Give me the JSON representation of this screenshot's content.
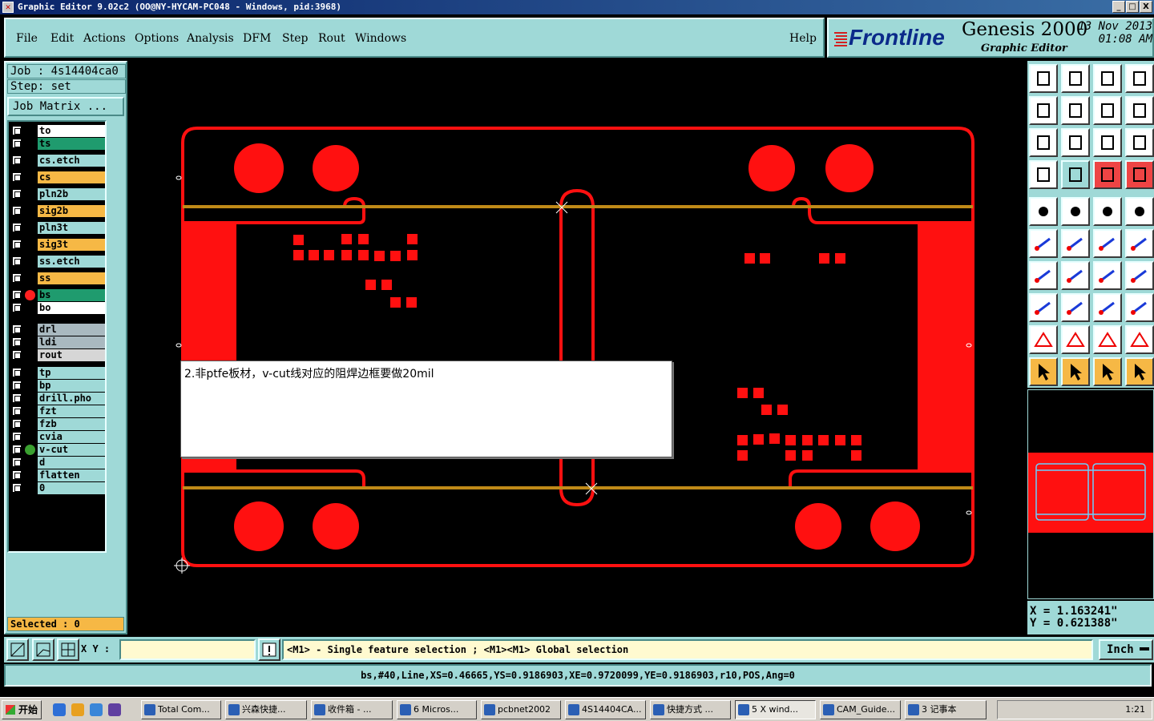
{
  "window": {
    "title": "Graphic Editor 9.02c2  (OO@NY-HYCAM-PC048 - Windows, pid:3968)",
    "min_label": "_",
    "max_label": "□",
    "close_label": "X"
  },
  "menu": {
    "items": [
      "File",
      "Edit",
      "Actions",
      "Options",
      "Analysis",
      "DFM",
      "Step",
      "Rout",
      "Windows"
    ],
    "help": "Help"
  },
  "logo": {
    "brand": "Frontline",
    "product": "Genesis 2000",
    "subtitle": "Graphic Editor",
    "date": "13 Nov 2013",
    "time": "01:08 AM"
  },
  "job": {
    "job_label": "Job : 4s14404ca0",
    "step_label": "Step: set",
    "matrix_button": "Job Matrix ..."
  },
  "layers": [
    {
      "name": "to",
      "color": "#ffffff",
      "dot": ""
    },
    {
      "name": "ts",
      "color": "#1f9b6e",
      "dot": ""
    },
    {
      "name": "cs.etch",
      "color": "#9fd9d7",
      "dot": ""
    },
    {
      "name": "cs",
      "color": "#f6b845",
      "dot": ""
    },
    {
      "name": "pln2b",
      "color": "#9fd9d7",
      "dot": ""
    },
    {
      "name": "sig2b",
      "color": "#f6b845",
      "dot": ""
    },
    {
      "name": "pln3t",
      "color": "#9fd9d7",
      "dot": ""
    },
    {
      "name": "sig3t",
      "color": "#f6b845",
      "dot": ""
    },
    {
      "name": "ss.etch",
      "color": "#9fd9d7",
      "dot": ""
    },
    {
      "name": "ss",
      "color": "#f6b845",
      "dot": ""
    },
    {
      "name": "bs",
      "color": "#1f9b6e",
      "dot": "#ff2020"
    },
    {
      "name": "bo",
      "color": "#ffffff",
      "dot": ""
    },
    {
      "name": "drl",
      "color": "#a9b9c0",
      "dot": ""
    },
    {
      "name": "ldi",
      "color": "#a9b9c0",
      "dot": ""
    },
    {
      "name": "rout",
      "color": "#d6d6d6",
      "dot": ""
    },
    {
      "name": "tp",
      "color": "#9fd9d7",
      "dot": ""
    },
    {
      "name": "bp",
      "color": "#9fd9d7",
      "dot": ""
    },
    {
      "name": "drill.pho",
      "color": "#9fd9d7",
      "dot": ""
    },
    {
      "name": "fzt",
      "color": "#9fd9d7",
      "dot": ""
    },
    {
      "name": "fzb",
      "color": "#9fd9d7",
      "dot": ""
    },
    {
      "name": "cvia",
      "color": "#9fd9d7",
      "dot": ""
    },
    {
      "name": "v-cut",
      "color": "#9fd9d7",
      "dot": "#3aa030"
    },
    {
      "name": "d",
      "color": "#9fd9d7",
      "dot": ""
    },
    {
      "name": "flatten",
      "color": "#9fd9d7",
      "dot": ""
    },
    {
      "name": "0",
      "color": "#9fd9d7",
      "dot": ""
    }
  ],
  "selected": "Selected : 0",
  "note": {
    "text": "2.非ptfe板材，v-cut线对应的阻焊边框要做20mil"
  },
  "coords": {
    "x": "X = 1.163241\"",
    "y": "Y = 0.621388\""
  },
  "command": {
    "xy_label": "X Y :",
    "xy_value": "",
    "hint": "<M1> - Single feature selection ; <M1><M1> Global selection",
    "units": "Inch"
  },
  "feature_info": "bs,#40,Line,XS=0.46665,YS=0.9186903,XE=0.9720099,YE=0.9186903,r10,POS,Ang=0",
  "taskbar": {
    "start": "开始",
    "tasks": [
      {
        "label": "Total Com...",
        "active": false
      },
      {
        "label": "兴森快捷...",
        "active": false
      },
      {
        "label": "收件箱 - ...",
        "active": false
      },
      {
        "label": "6 Micros...",
        "active": false
      },
      {
        "label": "pcbnet2002",
        "active": false
      },
      {
        "label": "4S14404CA...",
        "active": false
      },
      {
        "label": "快捷方式 ...",
        "active": false
      },
      {
        "label": "5 X wind...",
        "active": true
      },
      {
        "label": "CAM_Guide...",
        "active": false
      },
      {
        "label": "3 记事本",
        "active": false
      }
    ],
    "clock": "1:21"
  },
  "colors": {
    "panel": "#9fd9d7",
    "copper": "#ff1010",
    "vcut_line": "#c08a18",
    "highlight": "#f6b845"
  }
}
